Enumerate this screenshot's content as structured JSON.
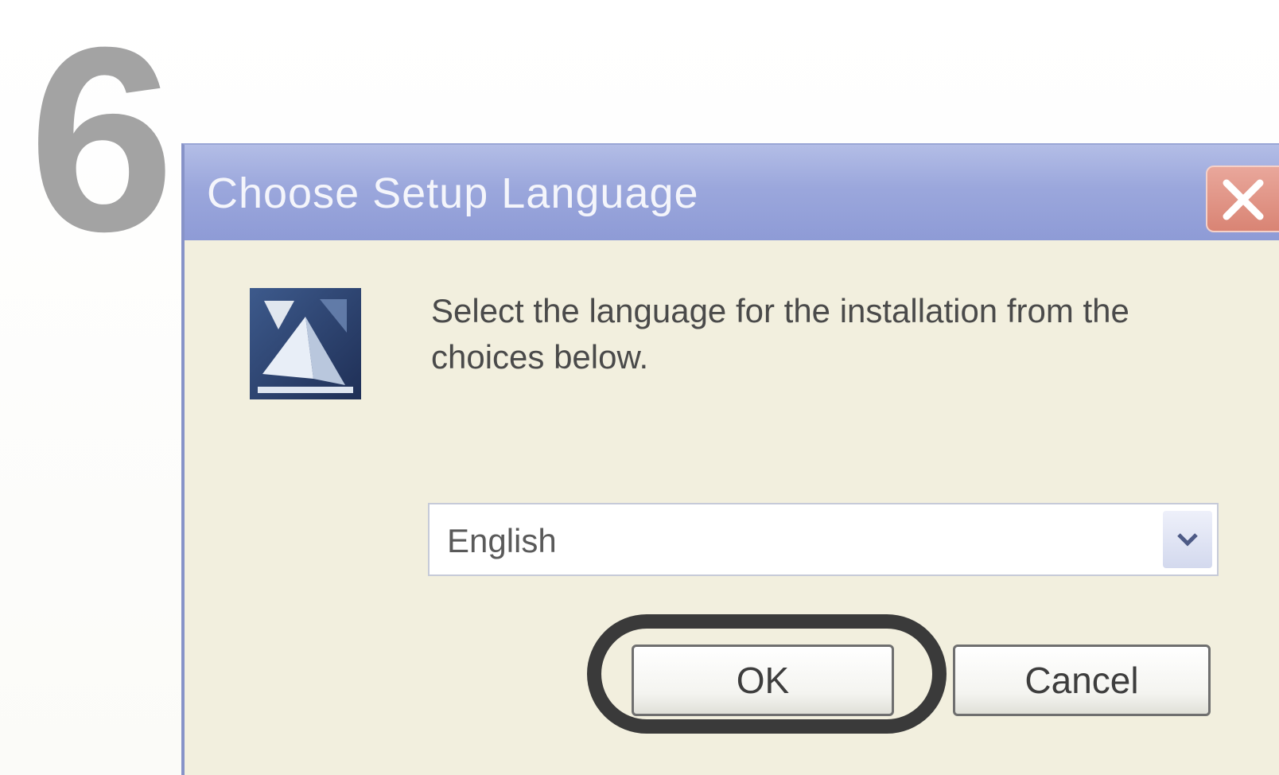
{
  "step": "6",
  "dialog": {
    "title": "Choose Setup Language",
    "message": "Select the language for the installation from the choices below.",
    "language_select": {
      "selected": "English"
    },
    "buttons": {
      "ok": "OK",
      "cancel": "Cancel"
    }
  },
  "icons": {
    "close": "close-icon",
    "setup": "setup-icon",
    "dropdown": "chevron-down-icon"
  },
  "colors": {
    "titlebar": "#9ba7dc",
    "dialog_bg": "#f2efde",
    "close_button": "#d98474",
    "highlight_ring": "#3a3a3a",
    "step_number": "#a3a3a3"
  }
}
